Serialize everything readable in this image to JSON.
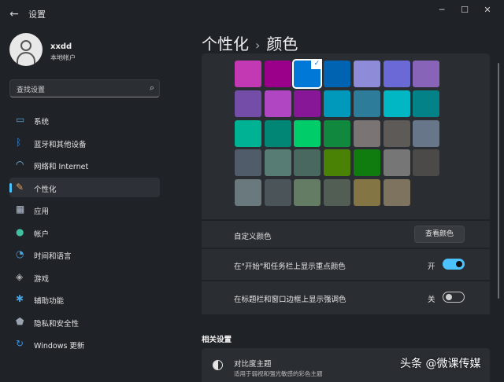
{
  "window": {
    "title": "设置",
    "back_glyph": "←",
    "minimize_glyph": "─",
    "maximize_glyph": "☐",
    "close_glyph": "✕"
  },
  "profile": {
    "name": "xxdd",
    "account_type": "本地帐户"
  },
  "search": {
    "placeholder": "查找设置",
    "icon": "search-icon"
  },
  "nav": {
    "items": [
      {
        "label": "系统",
        "icon": "monitor-icon",
        "color": "#4aa3df"
      },
      {
        "label": "蓝牙和其他设备",
        "icon": "bluetooth-icon",
        "color": "#3d8fe0"
      },
      {
        "label": "网络和 Internet",
        "icon": "wifi-icon",
        "color": "#6fc3f0"
      },
      {
        "label": "个性化",
        "icon": "brush-icon",
        "color": "#e8a060",
        "active": true
      },
      {
        "label": "应用",
        "icon": "apps-icon",
        "color": "#b8c4d4"
      },
      {
        "label": "帐户",
        "icon": "person-icon",
        "color": "#3fbfa0"
      },
      {
        "label": "时间和语言",
        "icon": "globe-clock-icon",
        "color": "#4aa3df"
      },
      {
        "label": "游戏",
        "icon": "gamepad-icon",
        "color": "#b0b0b0"
      },
      {
        "label": "辅助功能",
        "icon": "accessibility-icon",
        "color": "#4aa3df"
      },
      {
        "label": "隐私和安全性",
        "icon": "shield-icon",
        "color": "#9aa4b0"
      },
      {
        "label": "Windows 更新",
        "icon": "update-icon",
        "color": "#3d8fe0"
      }
    ]
  },
  "header": {
    "parent": "个性化",
    "separator": "›",
    "current": "颜色"
  },
  "swatches": {
    "rows": [
      [
        "#c239b3",
        "#9a0089",
        "#0078d7",
        "#0063b1",
        "#8e8cd8",
        "#6b69d6",
        "#8764b8"
      ],
      [
        "#744da9",
        "#b146c2",
        "#881798",
        "#0099bc",
        "#2d7d9a",
        "#00b7c3",
        "#038387"
      ],
      [
        "#00b294",
        "#018574",
        "#00cc6a",
        "#10893e",
        "#7a7574",
        "#5d5a58",
        "#68768a"
      ],
      [
        "#515c6b",
        "#567c73",
        "#486860",
        "#498205",
        "#107c10",
        "#767676",
        "#4c4a48"
      ],
      [
        "#69797e",
        "#4a5459",
        "#647c64",
        "#525e54",
        "#847545",
        "#7e735f"
      ]
    ],
    "selected_row": 0,
    "selected_col": 2,
    "check_glyph": "✓"
  },
  "custom_color": {
    "label": "自定义颜色",
    "button": "查看颜色"
  },
  "start_taskbar": {
    "label": "在\"开始\"和任务栏上显示重点颜色",
    "state": "开",
    "on": true
  },
  "title_bars": {
    "label": "在标题栏和窗口边框上显示强调色",
    "state": "关",
    "on": false
  },
  "related": {
    "section_title": "相关设置",
    "item_title": "对比度主题",
    "item_desc": "适用于弱视和强光敏感的彩色主题"
  },
  "watermark": "头条 @微课传媒",
  "accent_color": "#4cc2ff"
}
